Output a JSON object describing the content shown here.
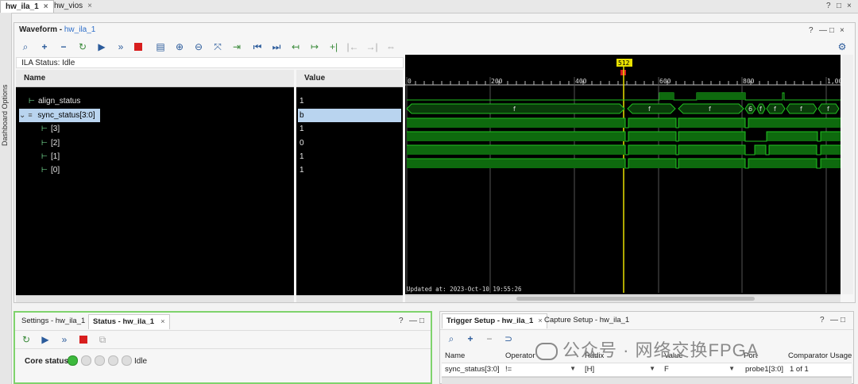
{
  "top_tabs": [
    {
      "label": "hw_ila_1",
      "close": "×"
    },
    {
      "label": "hw_vios",
      "close": "×"
    }
  ],
  "window_controls": {
    "help": "?",
    "min": "—",
    "max": "□",
    "close": "×"
  },
  "left_strip": {
    "label": "Dashboard Options"
  },
  "waveform": {
    "title": "Waveform - ",
    "title_link": "hw_ila_1",
    "ila_status": "ILA Status:  Idle",
    "name_header": "Name",
    "value_header": "Value",
    "signals": [
      {
        "name": "align_status",
        "value": "1"
      },
      {
        "name": "sync_status[3:0]",
        "value": "b",
        "selected": true
      },
      {
        "name": "[3]",
        "value": "1"
      },
      {
        "name": "[2]",
        "value": "0"
      },
      {
        "name": "[1]",
        "value": "1"
      },
      {
        "name": "[0]",
        "value": "1"
      }
    ],
    "ticks": [
      "0",
      "200",
      "400",
      "600",
      "800",
      "1,00"
    ],
    "cursor_label": "512",
    "bus_labels": [
      "f",
      "f",
      "f",
      "f",
      "6",
      "f",
      "f",
      "f",
      "f"
    ],
    "updated_at": "Updated at: 2023-Oct-10 19:55:26"
  },
  "status_panel": {
    "tabs": [
      "Settings - hw_ila_1",
      "Status - hw_ila_1"
    ],
    "tab_close": "×",
    "core_status_label": "Core status",
    "core_status_value": "Idle"
  },
  "trigger_panel": {
    "tabs": [
      "Trigger Setup - hw_ila_1",
      "Capture Setup - hw_ila_1"
    ],
    "tab_close": "×",
    "columns": [
      "Name",
      "Operator",
      "Radix",
      "Value",
      "Port",
      "Comparator Usage"
    ],
    "row": [
      "sync_status[3:0]",
      "!=",
      "[H]",
      "F",
      "probe1[3:0]",
      "1 of 1"
    ]
  },
  "watermark": "公众号 · 网络交换FPGA"
}
